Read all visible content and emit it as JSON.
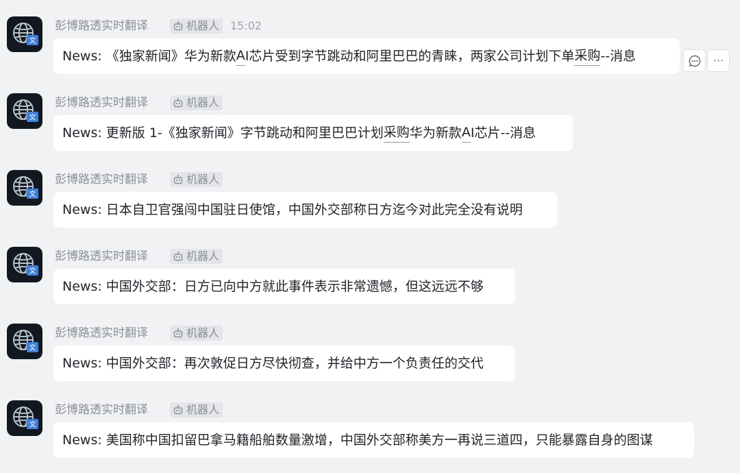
{
  "messages": [
    {
      "sender": "彭博路透实时翻译",
      "bot_tag": "机器人",
      "time": "15:02",
      "parts": [
        {
          "t": "News: 《独家新闻》华为新款"
        },
        {
          "t": "A",
          "u": true
        },
        {
          "t": "I芯片受到字节跳动和阿里巴巴的青睐，两家公司计划下单"
        },
        {
          "t": "采购",
          "u": true
        },
        {
          "t": "--消息"
        }
      ],
      "width": 914,
      "show_actions": true
    },
    {
      "sender": "彭博路透实时翻译",
      "bot_tag": "机器人",
      "parts": [
        {
          "t": "News: 更新版 1-《独家新闻》字节跳动和阿里巴巴计划"
        },
        {
          "t": "采购",
          "u": true
        },
        {
          "t": "华为新款"
        },
        {
          "t": "A",
          "u": true
        },
        {
          "t": "I芯片--消息"
        }
      ],
      "width": 758
    },
    {
      "sender": "彭博路透实时翻译",
      "bot_tag": "机器人",
      "parts": [
        {
          "t": "News: 日本自卫官强闯中国驻日使馆，中国外交部称日方迄今对此完全没有说明"
        }
      ],
      "width": 735
    },
    {
      "sender": "彭博路透实时翻译",
      "bot_tag": "机器人",
      "parts": [
        {
          "t": "News: 中国外交部：日方已向中方就此事件表示非常遗憾，但这远远不够"
        }
      ],
      "width": 674
    },
    {
      "sender": "彭博路透实时翻译",
      "bot_tag": "机器人",
      "parts": [
        {
          "t": "News: 中国外交部：再次敦促日方尽快彻查，并给中方一个负责任的交代"
        }
      ],
      "width": 674
    },
    {
      "sender": "彭博路透实时翻译",
      "bot_tag": "机器人",
      "parts": [
        {
          "t": "News: 美国称中国扣留巴拿马籍船舶数量激增，中国外交部称美方一再说三道四，只能暴露自身的图谋"
        }
      ],
      "width": 935
    }
  ],
  "actions": {
    "reply_icon": "comment-bubble-icon",
    "more_icon": "more-horizontal-icon",
    "more_label": "···"
  },
  "colors": {
    "background": "#f1f2f4",
    "bubble": "#ffffff",
    "avatar_bg": "#11181f",
    "avatar_accent": "#3d7fd9"
  }
}
